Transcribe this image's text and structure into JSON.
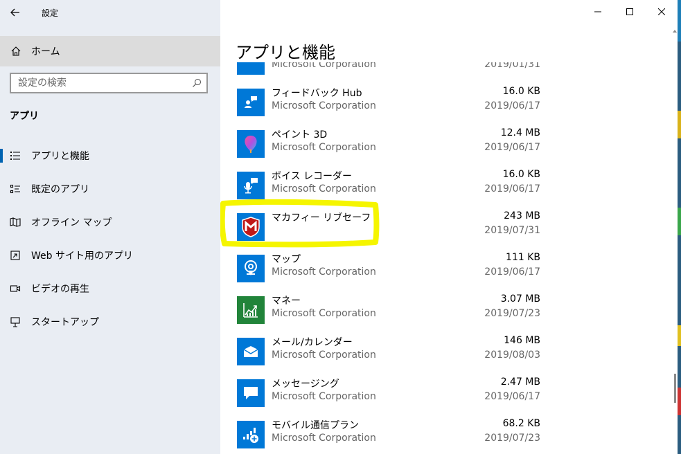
{
  "window": {
    "title": "設定"
  },
  "sidebar": {
    "home": {
      "label": "ホーム",
      "icon": "home-icon"
    },
    "search": {
      "placeholder": "設定の検索",
      "icon": "search-icon"
    },
    "section": "アプリ",
    "items": [
      {
        "label": "アプリと機能",
        "icon": "apps-features-icon",
        "selected": true
      },
      {
        "label": "既定のアプリ",
        "icon": "default-apps-icon",
        "selected": false
      },
      {
        "label": "オフライン マップ",
        "icon": "offline-maps-icon",
        "selected": false
      },
      {
        "label": "Web サイト用のアプリ",
        "icon": "websites-apps-icon",
        "selected": false
      },
      {
        "label": "ビデオの再生",
        "icon": "video-playback-icon",
        "selected": false
      },
      {
        "label": "スタートアップ",
        "icon": "startup-icon",
        "selected": false
      }
    ]
  },
  "main": {
    "title": "アプリと機能",
    "apps": [
      {
        "name": "",
        "publisher": "Microsoft Corporation",
        "size": "",
        "date": "2019/01/31",
        "icon": "app-icon",
        "tile_color": "#0078d7"
      },
      {
        "name": "フィードバック Hub",
        "publisher": "Microsoft Corporation",
        "size": "16.0 KB",
        "date": "2019/06/17",
        "icon": "feedback-hub-icon",
        "tile_color": "#0078d7"
      },
      {
        "name": "ペイント 3D",
        "publisher": "Microsoft Corporation",
        "size": "12.4 MB",
        "date": "2019/06/17",
        "icon": "paint-3d-icon",
        "tile_color": "#0078d7"
      },
      {
        "name": "ボイス レコーダー",
        "publisher": "Microsoft Corporation",
        "size": "16.0 KB",
        "date": "2019/06/17",
        "icon": "voice-recorder-icon",
        "tile_color": "#0078d7"
      },
      {
        "name": "マカフィー リブセーフ",
        "publisher": "",
        "size": "243 MB",
        "date": "2019/07/31",
        "icon": "mcafee-icon",
        "tile_color": "#0078d7"
      },
      {
        "name": "マップ",
        "publisher": "Microsoft Corporation",
        "size": "111 KB",
        "date": "2019/06/17",
        "icon": "maps-icon",
        "tile_color": "#0078d7"
      },
      {
        "name": "マネー",
        "publisher": "Microsoft Corporation",
        "size": "3.07 MB",
        "date": "2019/07/23",
        "icon": "money-icon",
        "tile_color": "#21843a"
      },
      {
        "name": "メール/カレンダー",
        "publisher": "Microsoft Corporation",
        "size": "146 MB",
        "date": "2019/08/03",
        "icon": "mail-calendar-icon",
        "tile_color": "#0078d7"
      },
      {
        "name": "メッセージング",
        "publisher": "Microsoft Corporation",
        "size": "2.47 MB",
        "date": "2019/06/17",
        "icon": "messaging-icon",
        "tile_color": "#0078d7"
      },
      {
        "name": "モバイル通信プラン",
        "publisher": "Microsoft Corporation",
        "size": "68.2 KB",
        "date": "2019/07/23",
        "icon": "mobile-plans-icon",
        "tile_color": "#0078d7"
      }
    ]
  },
  "colors": {
    "accent": "#0078d7",
    "highlight": "#f5f500",
    "sidebar_bg": "#e9edf3"
  }
}
